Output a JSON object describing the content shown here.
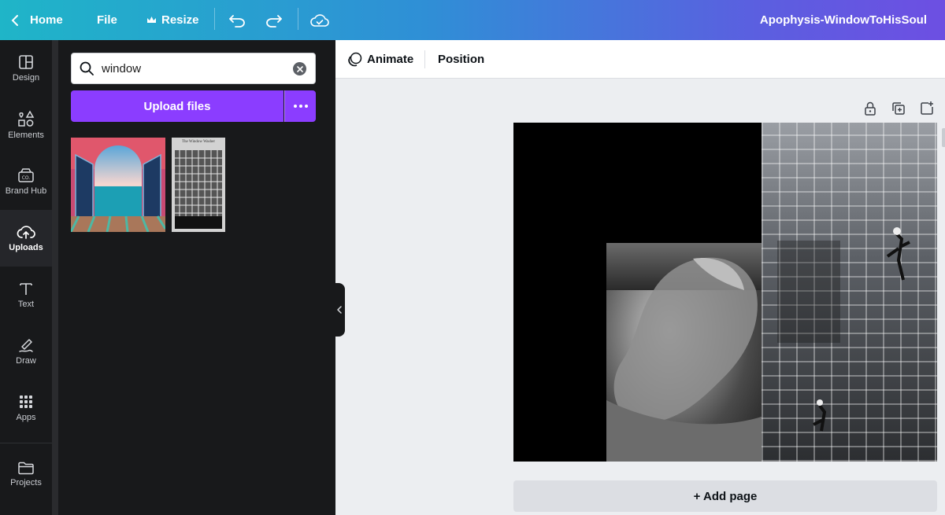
{
  "topbar": {
    "home_label": "Home",
    "file_label": "File",
    "resize_label": "Resize",
    "title": "Apophysis-WindowToHisSoul",
    "icons": [
      "chevron-left-icon",
      "crown-icon",
      "undo-icon",
      "redo-icon",
      "cloud-check-icon"
    ]
  },
  "rail": {
    "items": [
      {
        "label": "Design",
        "icon": "layout-icon"
      },
      {
        "label": "Elements",
        "icon": "shapes-icon"
      },
      {
        "label": "Brand Hub",
        "icon": "brand-icon"
      },
      {
        "label": "Uploads",
        "icon": "upload-cloud-icon",
        "active": true
      },
      {
        "label": "Text",
        "icon": "text-icon"
      },
      {
        "label": "Draw",
        "icon": "pen-icon"
      },
      {
        "label": "Apps",
        "icon": "grid-icon"
      },
      {
        "label": "Projects",
        "icon": "folder-icon"
      }
    ]
  },
  "panel": {
    "search_value": "window",
    "upload_label": "Upload files",
    "thumbnails": [
      "open-window-sea-image",
      "window-washer-poster-image"
    ],
    "thumb_b_caption": "The Window Washer"
  },
  "context_toolbar": {
    "animate_label": "Animate",
    "position_label": "Position"
  },
  "canvas": {
    "add_page_label": "+ Add page",
    "page_tools": [
      "lock-icon",
      "duplicate-icon",
      "add-page-icon"
    ]
  },
  "colors": {
    "accent": "#8b3dff",
    "panel_bg": "#18191b",
    "canvas_bg": "#eceef1"
  }
}
